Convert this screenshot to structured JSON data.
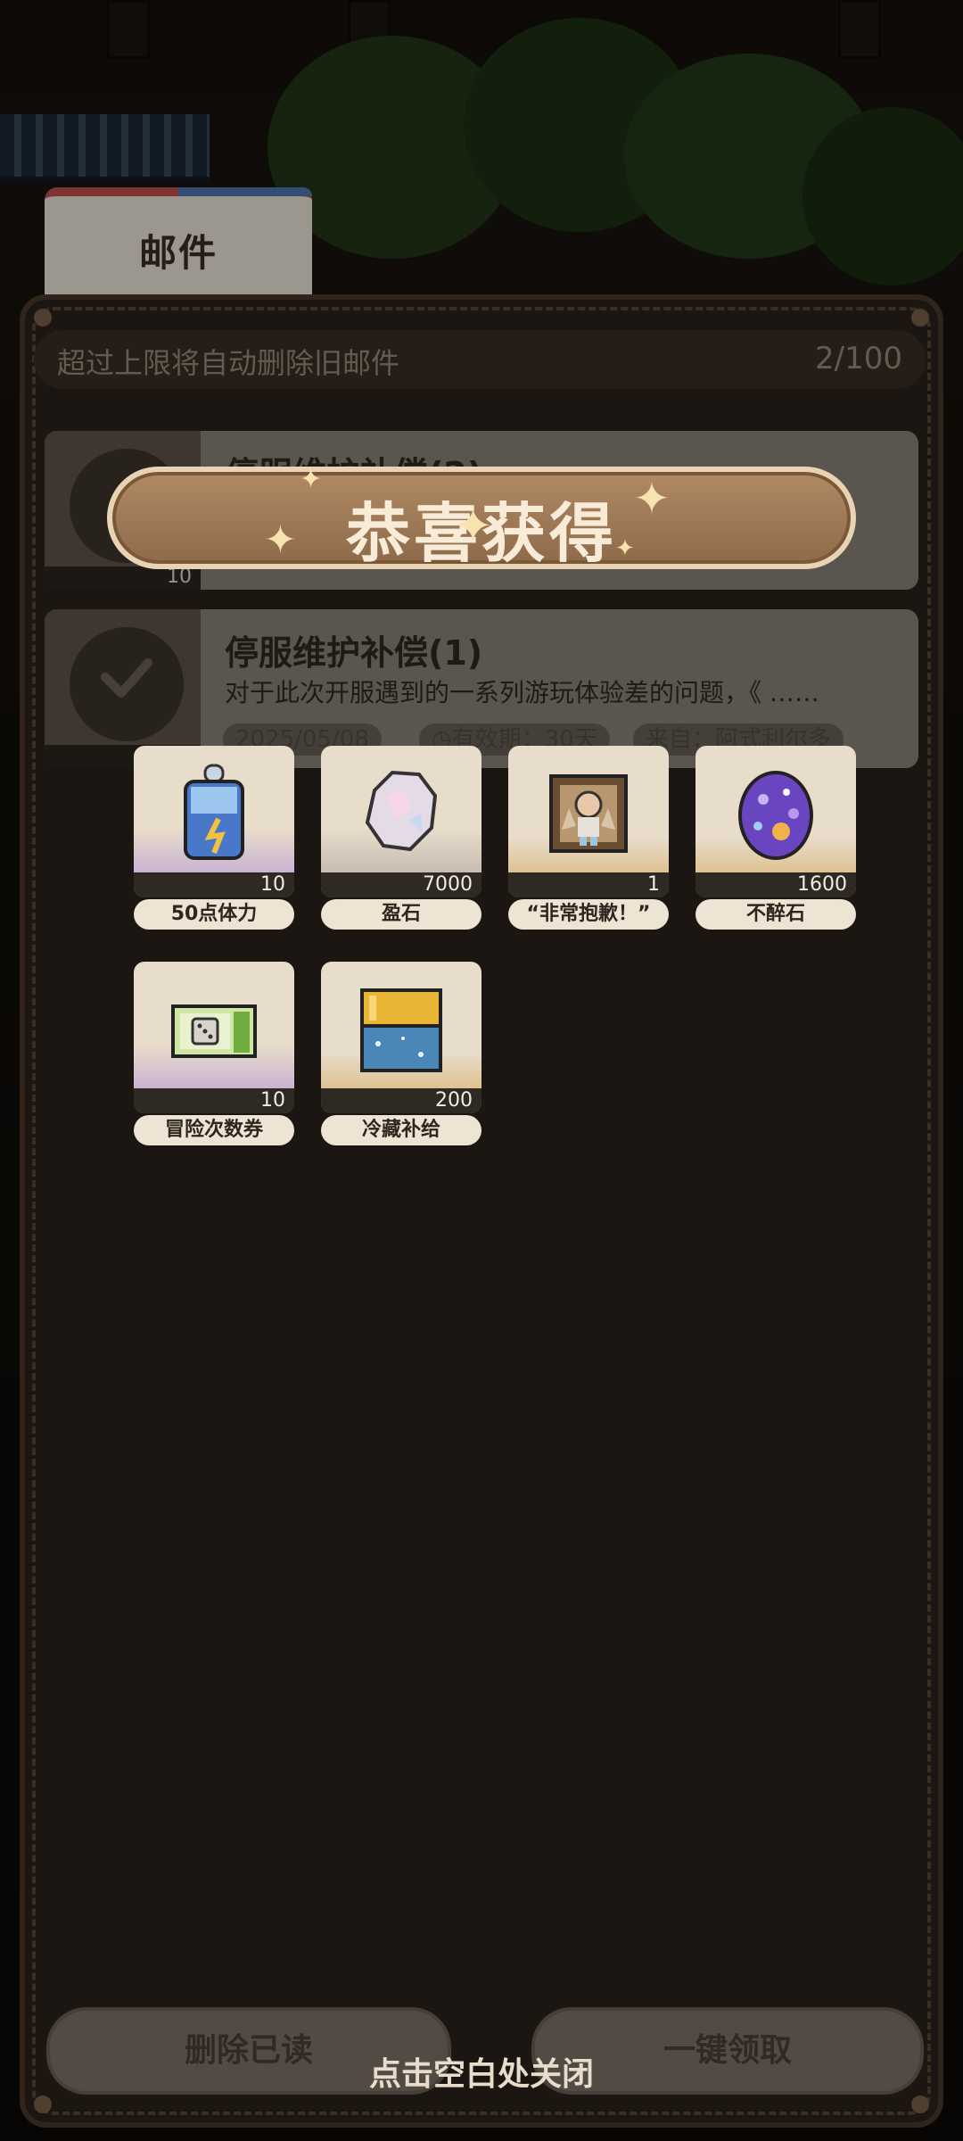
{
  "mail": {
    "tab_label": "邮件",
    "notice": "超过上限将自动删除旧邮件",
    "count": "2/100",
    "items": [
      {
        "title": "停服维护补偿(2)",
        "thumb_count": "10"
      },
      {
        "title": "停服维护补偿(1)",
        "body": "对于此次开服遇到的一系列游玩体验差的问题，《 ……",
        "date": "2025/05/08",
        "validity": "有效期：30天",
        "sender": "来自：阿式利尔多"
      }
    ],
    "delete_read_label": "删除已读",
    "claim_all_label": "一键领取"
  },
  "reward_popup": {
    "title": "恭喜获得",
    "close_hint": "点击空白处关闭",
    "items": [
      {
        "name": "50点体力",
        "qty": "10",
        "icon": "stamina-potion-icon",
        "rarity_color": "#b99bd6"
      },
      {
        "name": "盈石",
        "qty": "7000",
        "icon": "crystal-ore-icon",
        "rarity_color": "#b5aaa0"
      },
      {
        "name": "“非常抱歉！”",
        "qty": "1",
        "icon": "apology-figure-icon",
        "rarity_color": "#d8b06a"
      },
      {
        "name": "不醉石",
        "qty": "1600",
        "icon": "purple-egg-gem-icon",
        "rarity_color": "#d8b06a"
      },
      {
        "name": "冒险次数券",
        "qty": "10",
        "icon": "dice-ticket-icon",
        "rarity_color": "#b99bd6"
      },
      {
        "name": "冷藏补给",
        "qty": "200",
        "icon": "cooler-box-icon",
        "rarity_color": "#d8b06a"
      }
    ]
  }
}
